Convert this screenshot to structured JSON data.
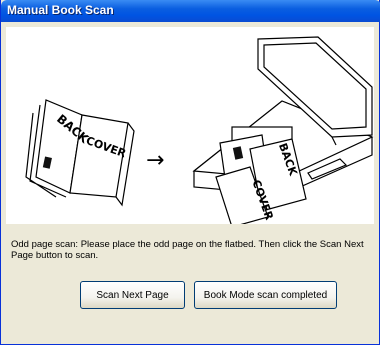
{
  "window": {
    "title": "Manual Book Scan"
  },
  "illustration": {
    "book_back_label": "BACK",
    "book_cover_label": "COVER",
    "arrow_glyph": "→"
  },
  "instruction": "Odd page scan: Please place the odd page on the flatbed. Then click the Scan Next Page button to scan.",
  "buttons": {
    "scan_next_page": "Scan Next Page",
    "book_mode_completed": "Book Mode scan completed"
  },
  "colors": {
    "titlebar": "#0054e3",
    "window_bg": "#ece9d8",
    "button_border": "#003c74"
  }
}
